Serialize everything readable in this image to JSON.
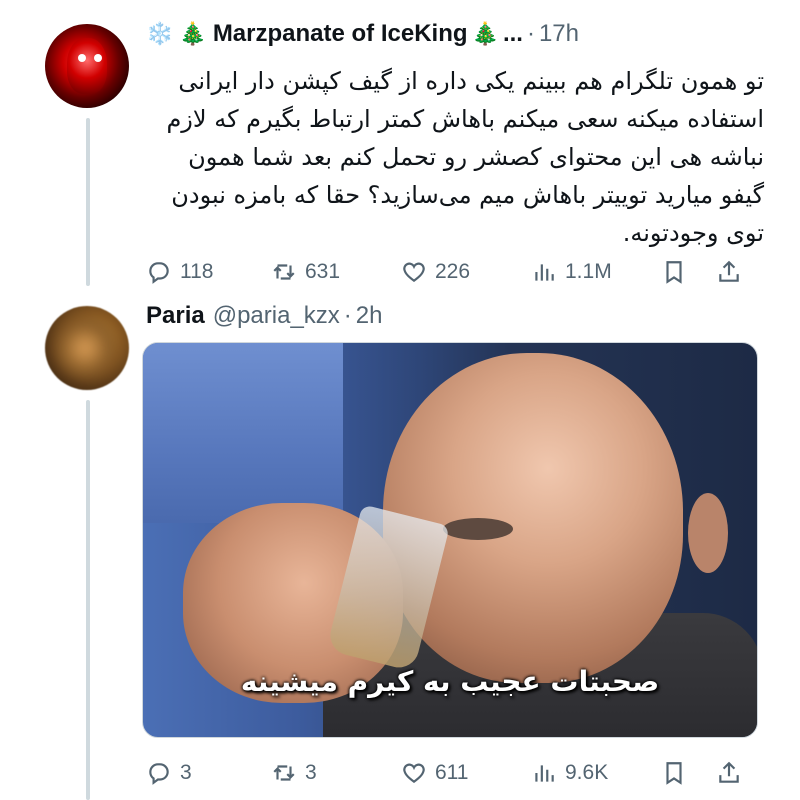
{
  "tweets": [
    {
      "author_name": "Marzpanate of IceKing",
      "emoji_prefix": "❄️",
      "emoji_tree": "🎄",
      "emoji_tree_end": "🎄",
      "ellipsis": "...",
      "dot": "·",
      "time": "17h",
      "text": "تو همون تلگرام هم ببینم یکی داره از گیف کپشن دار ایرانی استفاده میکنه سعی میکنم باهاش کمتر ارتباط بگیرم که لازم نباشه هی این محتوای کصشر رو تحمل کنم بعد شما همون گیفو میارید توییتر باهاش میم می‌سازید؟ حقا که بامزه نبودن توی وجودتونه.",
      "replies": "118",
      "retweets": "631",
      "likes": "226",
      "views": "1.1M"
    },
    {
      "author_name": "Paria",
      "handle": "@paria_kzx",
      "dot": "·",
      "time": "2h",
      "media_caption": "صحبتات عجیب به کیرم میشینه",
      "replies": "3",
      "retweets": "3",
      "likes": "611",
      "views": "9.6K"
    }
  ],
  "icons": [
    "reply-icon",
    "retweet-icon",
    "like-icon",
    "views-icon",
    "bookmark-icon",
    "share-icon"
  ],
  "colors": {
    "text": "#0f1419",
    "muted": "#536471",
    "thread_line": "#cfd9de"
  }
}
